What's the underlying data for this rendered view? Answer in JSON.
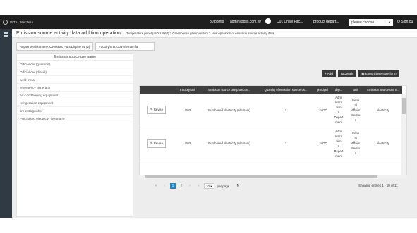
{
  "topbar": {
    "logo": "VITAL NetZero",
    "points": "30 points",
    "email": "admin@gss.com.tw",
    "company": "C01 Chayi Fac...",
    "department": "product depart...",
    "please_choose": "please choose",
    "sign_out": "Sign ou"
  },
  "page": {
    "title": "Emission source activity data addition operation",
    "breadcrumb": "Temperature panel (ISO 14064) > Greenhouse gas inventory > New operation of emission source activity data"
  },
  "filters": [
    {
      "label": "Report version name",
      "value": "Overseas Plant Display 01 (2)"
    },
    {
      "label": "Factory/unit",
      "value": "G03-Vietnam fa"
    }
  ],
  "left_panel": {
    "header": "Emission source use name",
    "items": [
      "Official car (gasoline)",
      "Official car (diesel)",
      "weld metal",
      "emergency generator",
      "Air-conditioning equipment",
      "refrigeration equipment",
      "fire extinguisher",
      "Purchased electricity (Vietnam)"
    ]
  },
  "actions": {
    "add": "+ Add",
    "details": "Details",
    "export": "Export inventory form"
  },
  "table": {
    "columns": [
      "",
      "Factory/unit",
      "Emission source use project n...",
      "Quantity of emission source us...",
      "principal",
      "dep...",
      "unit",
      "Emission source use n..."
    ],
    "rows": [
      {
        "action": "Revise",
        "factory": "G03",
        "project": "Purchased electricity (Vietnam)",
        "quantity": "1",
        "principal": "Lin OO",
        "dep": [
          "Admi",
          "nistra",
          "tion",
          "n",
          "Depart",
          "ment"
        ],
        "unit": [
          "Gene",
          "al",
          "Affairs",
          "Sectio",
          "n"
        ],
        "use_name": "electricity"
      },
      {
        "action": "Revise",
        "factory": "G03",
        "project": "Purchased electricity (Vietnam)",
        "quantity": "1",
        "principal": "Lin OO",
        "dep": [
          "Admi",
          "nistra",
          "tion",
          "n",
          "Depart",
          "ment"
        ],
        "unit": [
          "Gene",
          "al",
          "Affairs",
          "Sectio",
          "n"
        ],
        "use_name": "electricity"
      }
    ]
  },
  "pagination": {
    "first": "«",
    "prev": "‹",
    "pages": [
      "1",
      "2"
    ],
    "next": "›",
    "last": "»",
    "page_size": "10",
    "per_page": "per page",
    "refresh": "↻",
    "entries": "Showing entries 1 - 10 of 11"
  }
}
